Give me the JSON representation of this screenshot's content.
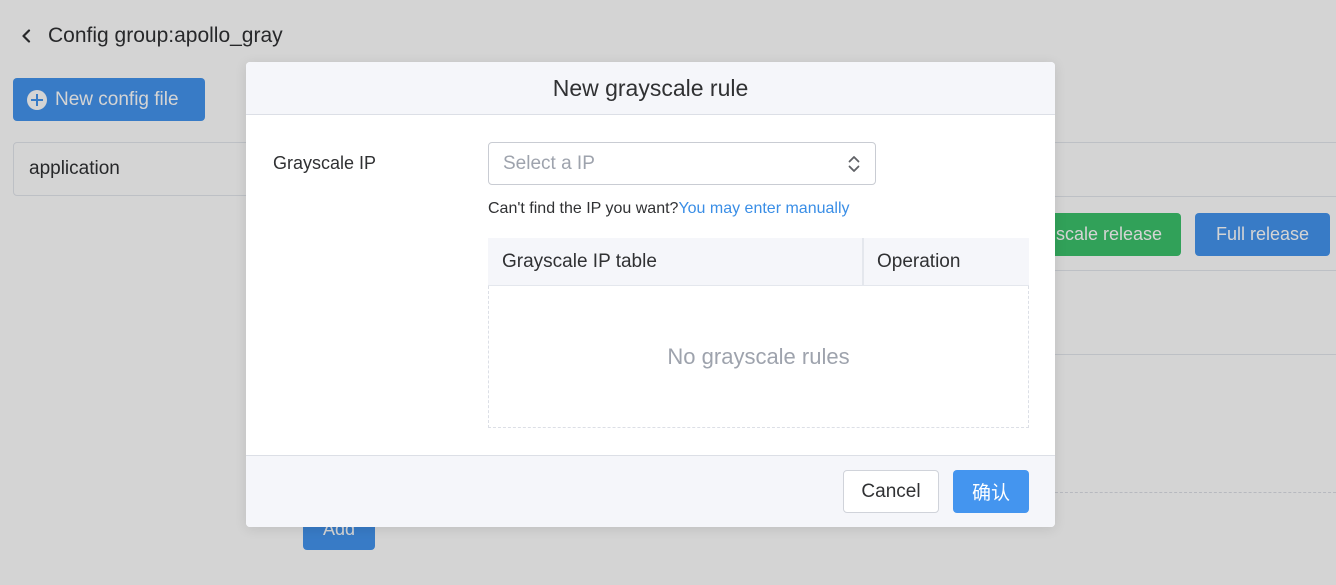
{
  "page": {
    "title": "Config group:apollo_gray",
    "new_config_label": "New config file",
    "file_tab": "application",
    "gray_release_label": "scale release",
    "full_release_label": "Full release",
    "add_label": "Add"
  },
  "modal": {
    "title": "New grayscale rule",
    "ip_label": "Grayscale IP",
    "ip_select_placeholder": "Select a IP",
    "hint_text": "Can't find the IP you want?",
    "hint_link": "You may enter manually",
    "table": {
      "col_ip": "Grayscale IP table",
      "col_operation": "Operation",
      "empty_text": "No grayscale rules"
    },
    "cancel_label": "Cancel",
    "confirm_label": "确认"
  },
  "colors": {
    "primary": "#4495ef",
    "success": "#3bc26b",
    "link": "#3a8ee6",
    "overlay": "rgba(0,0,0,0.17)"
  },
  "icons": [
    "chevron-left-icon",
    "plus-circle-icon",
    "select-updown-icon"
  ]
}
